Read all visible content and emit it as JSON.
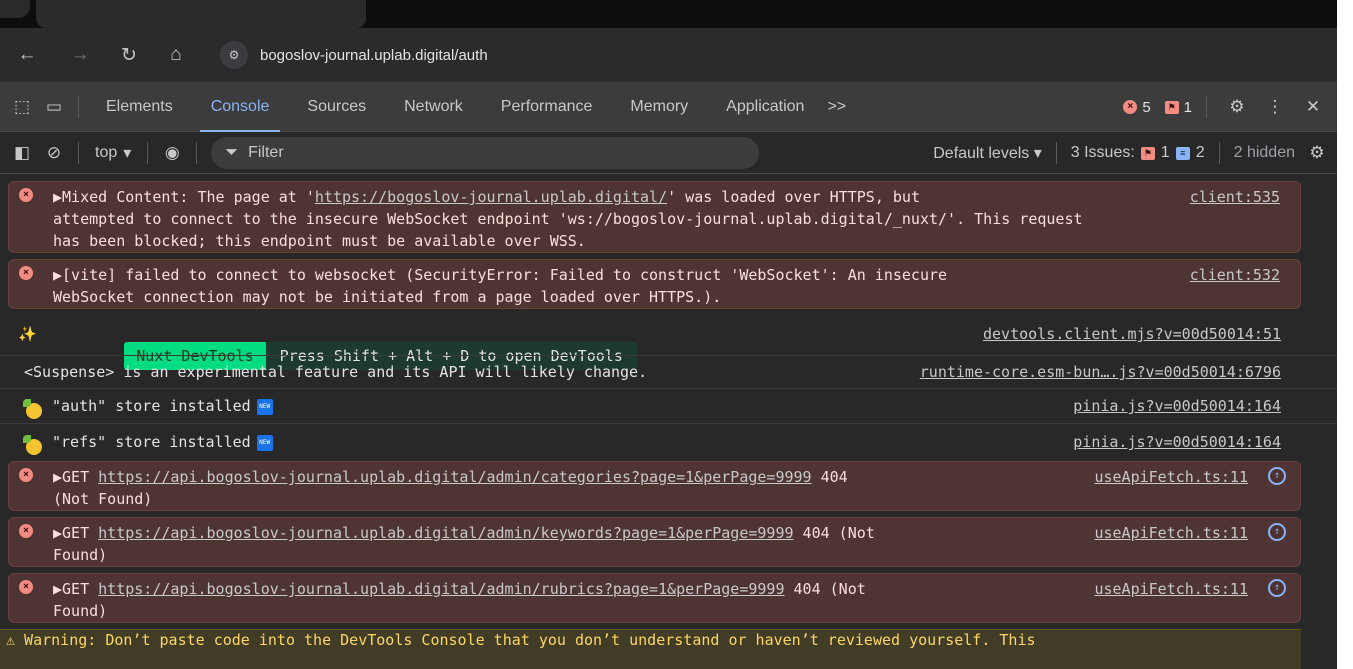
{
  "browser": {
    "url": "bogoslov-journal.uplab.digital/auth"
  },
  "devtools": {
    "tabs": [
      {
        "label": "Elements"
      },
      {
        "label": "Console"
      },
      {
        "label": "Sources"
      },
      {
        "label": "Network"
      },
      {
        "label": "Performance"
      },
      {
        "label": "Memory"
      },
      {
        "label": "Application"
      }
    ],
    "more_tabs": ">>",
    "error_count": "5",
    "issue_count": "1"
  },
  "console_toolbar": {
    "context": "top",
    "filter_placeholder": "Filter",
    "levels": "Default levels",
    "issues_label": "3 Issues:",
    "issues_errors": "1",
    "issues_info": "2",
    "hidden": "2 hidden"
  },
  "messages": {
    "m1": {
      "text": "▶Mixed Content: The page at '",
      "link": "https://bogoslov-journal.uplab.digital/",
      "text2": "' was loaded over HTTPS, but\nattempted to connect to the insecure WebSocket endpoint 'ws://bogoslov-journal.uplab.digital/_nuxt/'. This request\nhas been blocked; this endpoint must be available over WSS.",
      "source": "client:535"
    },
    "m2": {
      "text": "▶[vite] failed to connect to websocket (SecurityError: Failed to construct 'WebSocket': An insecure\nWebSocket connection may not be initiated from a page loaded over HTTPS.).",
      "source": "client:532"
    },
    "m3": {
      "badge_left": "Nuxt DevTools",
      "badge_right": "Press Shift + Alt + D to open DevTools",
      "source": "devtools.client.mjs?v=00d50014:51"
    },
    "m4": {
      "text": "<Suspense> is an experimental feature and its API will likely change.",
      "source": "runtime-core.esm-bun….js?v=00d50014:6796"
    },
    "m5": {
      "text": "\"auth\" store installed",
      "source": "pinia.js?v=00d50014:164"
    },
    "m6": {
      "text": "\"refs\" store installed",
      "source": "pinia.js?v=00d50014:164"
    },
    "m7": {
      "prefix": "▶GET ",
      "link": "https://api.bogoslov-journal.uplab.digital/admin/categories?page=1&perPage=9999",
      "suffix": " 404\n(Not Found)",
      "source": "useApiFetch.ts:11"
    },
    "m8": {
      "prefix": "▶GET ",
      "link": "https://api.bogoslov-journal.uplab.digital/admin/keywords?page=1&perPage=9999",
      "suffix": " 404 (Not\nFound)",
      "source": "useApiFetch.ts:11"
    },
    "m9": {
      "prefix": "▶GET ",
      "link": "https://api.bogoslov-journal.uplab.digital/admin/rubrics?page=1&perPage=9999",
      "suffix": " 404 (Not\nFound)",
      "source": "useApiFetch.ts:11"
    },
    "warning": "⚠ Warning: Don’t paste code into the DevTools Console that you don’t understand or haven’t reviewed yourself. This"
  }
}
